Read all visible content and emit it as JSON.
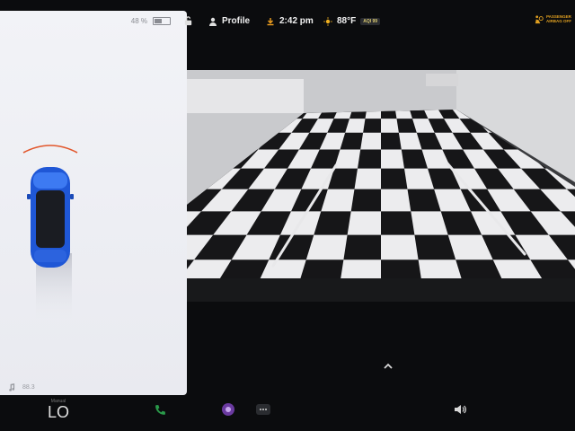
{
  "left_panel": {
    "battery_text": "48 %",
    "battery_fraction": 0.48,
    "media_text": "88.3",
    "car_color": "#1f57d6"
  },
  "status_bar": {
    "profile_label": "Profile",
    "time": "2:42 pm",
    "temperature": "88°F",
    "aqi_badge": "AQI 99",
    "airbag_label": "PASSENGER AIRBAG OFF"
  },
  "bottom_bar": {
    "climate_label": "Manual",
    "climate_value": "LO"
  },
  "icons": {
    "lock": "lock-icon",
    "profile": "person-icon",
    "download": "download-icon",
    "sun": "sun-icon",
    "airbag": "airbag-icon",
    "music": "music-note-icon",
    "phone": "phone-icon",
    "camera_app": "camera-app-icon",
    "more": "more-icon",
    "volume": "volume-icon",
    "chevron": "chevron-up-icon"
  }
}
